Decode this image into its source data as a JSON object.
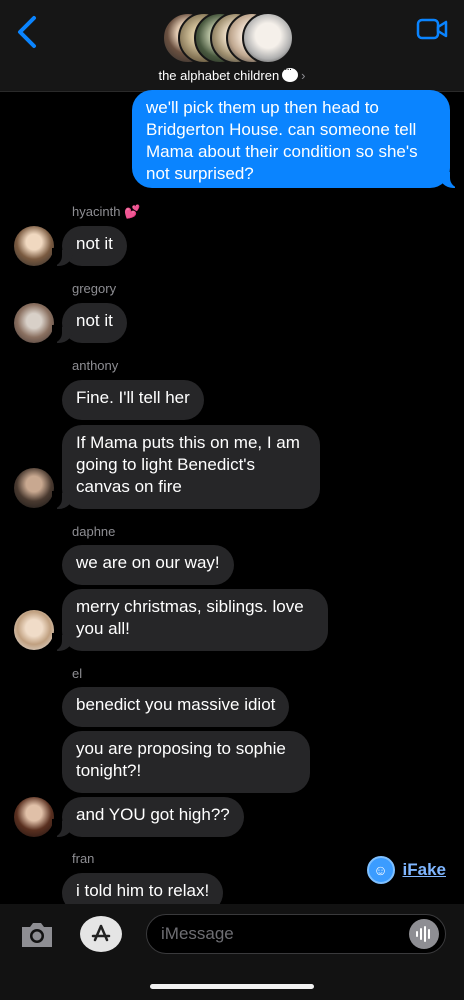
{
  "header": {
    "group_name": "the alphabet children",
    "chevron": "›"
  },
  "icons": {
    "back": "chevron-left-icon",
    "video": "video-camera-icon",
    "camera": "camera-icon",
    "appstore": "app-store-icon",
    "mic": "audio-waveform-icon"
  },
  "colors": {
    "accent": "#0a84ff",
    "incoming_bubble": "#262628",
    "background": "#000000"
  },
  "messages": [
    {
      "from": "me",
      "text": "we'll pick them up then head to Bridgerton House. can someone tell Mama about their condition so she's not surprised?"
    },
    {
      "sender": "hyacinth",
      "sender_emoji": "💕",
      "text": "not it"
    },
    {
      "sender": "gregory",
      "text": "not it"
    },
    {
      "sender": "anthony",
      "text": "Fine. I'll tell her"
    },
    {
      "text": "If Mama puts this on me, I am going to light Benedict's canvas on fire"
    },
    {
      "sender": "daphne",
      "text": "we are on our way!"
    },
    {
      "text": "merry christmas, siblings. love you all!"
    },
    {
      "sender": "el",
      "text": "benedict you massive idiot"
    },
    {
      "text": "you are proposing to sophie tonight?!"
    },
    {
      "text": "and YOU got high??"
    },
    {
      "sender": "fran",
      "text": "i told him to relax!"
    }
  ],
  "watermark": {
    "text": "iFake"
  },
  "input": {
    "placeholder": "iMessage"
  }
}
